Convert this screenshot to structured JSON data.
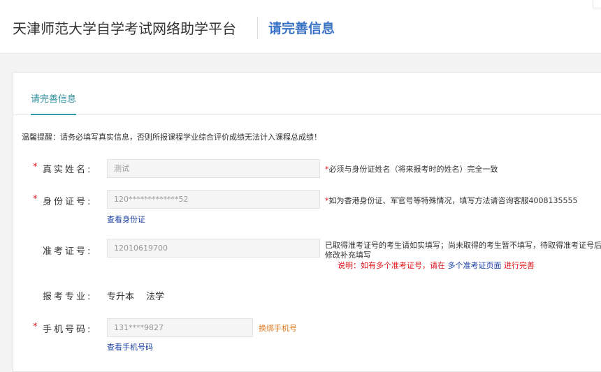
{
  "header": {
    "site_title": "天津师范大学自学考试网络助学平台",
    "page_subtitle": "请完善信息"
  },
  "tabs": [
    {
      "label": "请完善信息"
    }
  ],
  "notice": "温馨提醒：请务必填写真实信息，否则所报课程学业综合评价成绩无法计入课程总成绩！",
  "form": {
    "name": {
      "required_mark": "*",
      "label": "真实姓名:",
      "value": "测试",
      "hint_star": "*",
      "hint": "必须与身份证姓名（将来报考时的姓名）完全一致"
    },
    "id_card": {
      "required_mark": "*",
      "label": "身份证号:",
      "value": "120*************52",
      "hint_star": "*",
      "hint": "如为香港身份证、军官号等特殊情况，填写方法请咨询客服4008135555",
      "link": "查看身份证"
    },
    "exam_no": {
      "label": "准考证号:",
      "value": "12010619700",
      "hint_line1": "已取得准考证号的考生请如实填写；尚未取得的考生暂不填写，待取得准考证号后",
      "hint_line2": "修改补充填写",
      "note_prefix": "说明：如有多个准考证号，请在",
      "note_link": "多个准考证页面",
      "note_suffix": "进行完善"
    },
    "major": {
      "label": "报考专业:",
      "level": "专升本",
      "major": "法学"
    },
    "phone": {
      "required_mark": "*",
      "label": "手机号码:",
      "value": "131****9827",
      "bind_link": "换绑手机号",
      "view_link": "查看手机号码"
    }
  },
  "colors": {
    "accent_blue": "#3a73c6",
    "tab_teal": "#2f8f9d",
    "required_red": "#e0161b",
    "link_blue": "#1a3fa0",
    "link_orange": "#e0781e"
  }
}
